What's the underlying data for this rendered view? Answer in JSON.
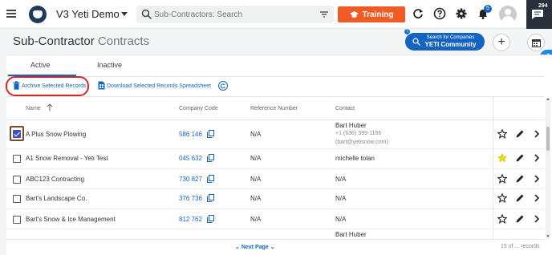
{
  "app": {
    "name": "V3 Yeti Demo"
  },
  "search": {
    "placeholder": "Sub-Contractors: Search"
  },
  "toolbar": {
    "training_label": "Training",
    "notification_count": "5",
    "chat_count": "294"
  },
  "page": {
    "title": "Sub-Contractor",
    "subtitle": "Contracts"
  },
  "community": {
    "line1": "Search for Companies",
    "line2": "YETI Community"
  },
  "tabs": [
    {
      "label": "Active"
    },
    {
      "label": "Inactive"
    }
  ],
  "actions": {
    "archive": "Archive Selected Records",
    "download": "Download Selected Records Spreadsheet"
  },
  "columns": {
    "name": "Name",
    "company_code": "Company Code",
    "reference": "Reference Number",
    "contact": "Contact"
  },
  "rows": [
    {
      "name": "A Plus Snow Plowing",
      "code": "586 146",
      "reference": "N/A",
      "contact": "Bart Huber",
      "contact_phone": "+1 (636) 399-1166",
      "contact_email": "(bart@yetisnow.com)",
      "checked": true,
      "starred": false
    },
    {
      "name": "A1 Snow Removal - Yeti Test",
      "code": "045 632",
      "reference": "N/A",
      "contact": "michelle tolan",
      "checked": false,
      "starred": true
    },
    {
      "name": "ABC123 Contracting",
      "code": "730 827",
      "reference": "N/A",
      "contact": "N/A",
      "checked": false,
      "starred": false
    },
    {
      "name": "Bart's Landscape Co.",
      "code": "376 736",
      "reference": "N/A",
      "contact": "N/A",
      "checked": false,
      "starred": false
    },
    {
      "name": "Bart's Snow & Ice Management",
      "code": "812 762",
      "reference": "N/A",
      "contact": "N/A",
      "checked": false,
      "starred": false
    },
    {
      "contact": "Bart Huber"
    }
  ],
  "footer": {
    "next_page": "Next Page",
    "records": "15 of ... records"
  },
  "colors": {
    "accent": "#1565c0",
    "training": "#f05a24",
    "star_active": "#e8e000",
    "highlight": "#d8232a"
  }
}
